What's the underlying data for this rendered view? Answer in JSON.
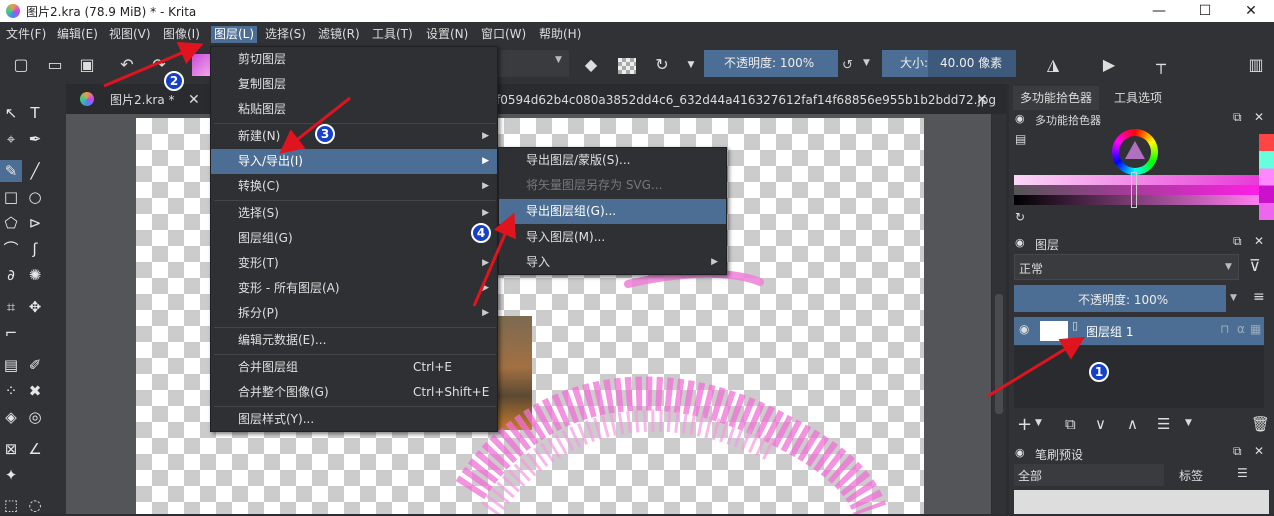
{
  "window": {
    "title": "图片2.kra (78.9 MiB)  * - Krita",
    "minimize": "—",
    "maximize": "☐",
    "close": "✕"
  },
  "menubar": [
    "文件(F)",
    "编辑(E)",
    "视图(V)",
    "图像(I)",
    "图层(L)",
    "选择(S)",
    "滤镜(R)",
    "工具(T)",
    "设置(N)",
    "窗口(W)",
    "帮助(H)"
  ],
  "toolbar": {
    "opacity_label": "不透明度: 100%",
    "size_label": "大小:",
    "size_value": "40.00 像素"
  },
  "tabs": [
    {
      "label": "图片2.kra *",
      "close": "✕"
    },
    {
      "label": "f0594d62b4c080a3852dd4c6_632d44a416327612faf14f68856e955b1b2bdd72.jpg",
      "close": "✕"
    }
  ],
  "layer_menu": {
    "items": [
      {
        "label": "剪切图层"
      },
      {
        "label": "复制图层"
      },
      {
        "label": "粘贴图层"
      },
      {
        "label": "新建(N)",
        "submenu": true
      },
      {
        "label": "导入/导出(I)",
        "submenu": true,
        "highlighted": true
      },
      {
        "label": "转换(C)",
        "submenu": true
      },
      {
        "label": "选择(S)",
        "submenu": true
      },
      {
        "label": "图层组(G)",
        "submenu": true
      },
      {
        "label": "变形(T)",
        "submenu": true
      },
      {
        "label": "变形 - 所有图层(A)",
        "submenu": true
      },
      {
        "label": "拆分(P)",
        "submenu": true
      },
      {
        "label": "编辑元数据(E)..."
      },
      {
        "label": "合并图层组",
        "shortcut": "Ctrl+E"
      },
      {
        "label": "合并整个图像(G)",
        "shortcut": "Ctrl+Shift+E"
      },
      {
        "label": "图层样式(Y)..."
      }
    ]
  },
  "import_export_menu": {
    "items": [
      {
        "label": "导出图层/蒙版(S)..."
      },
      {
        "label": "将矢量图层另存为 SVG...",
        "disabled": true
      },
      {
        "label": "导出图层组(G)...",
        "highlighted": true
      },
      {
        "label": "导入图层(M)..."
      },
      {
        "label": "导入",
        "submenu": true
      }
    ]
  },
  "right_dock": {
    "tabs": [
      "多功能拾色器",
      "工具选项"
    ],
    "color_picker_title": "多功能拾色器",
    "layers_title": "图层",
    "blend_mode": "正常",
    "layer_opacity": "不透明度: 100%",
    "layer_name": "图层组 1",
    "brush_presets_title": "笔刷预设",
    "brush_filter": "全部",
    "brush_tag": "标签"
  },
  "annotations": [
    "1",
    "2",
    "3",
    "4"
  ],
  "colors": {
    "accent": "#4d6e94",
    "bg": "#313236",
    "canvas": "#545559",
    "arrow": "#e0141e",
    "badge": "#1540c8"
  }
}
